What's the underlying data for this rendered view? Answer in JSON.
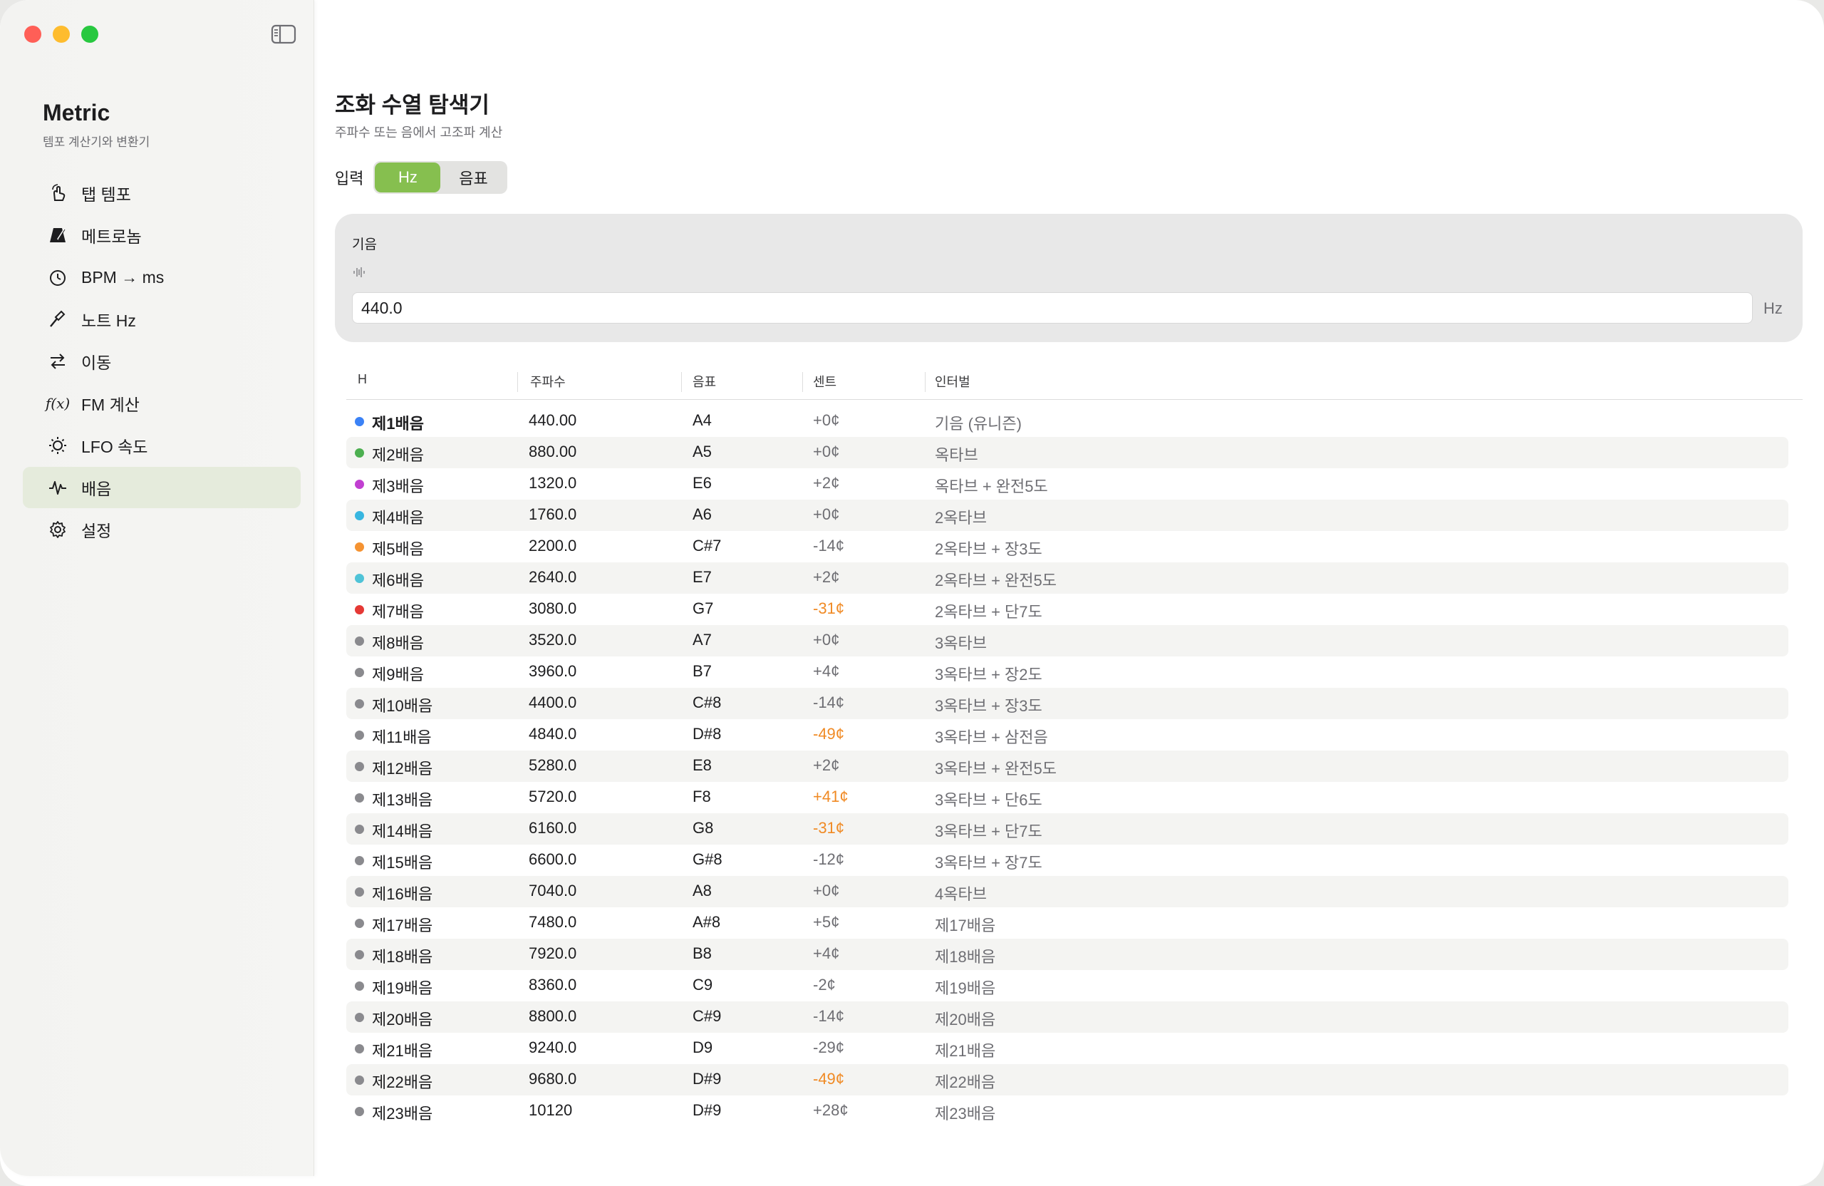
{
  "app": {
    "title": "Metric",
    "subtitle": "템포 계산기와 변환기"
  },
  "sidebar": {
    "items": [
      {
        "label": "탭 템포",
        "icon": "tap-icon"
      },
      {
        "label": "메트로놈",
        "icon": "metronome-icon"
      },
      {
        "label": "BPM → ms",
        "icon": "timer-icon"
      },
      {
        "label": "노트 Hz",
        "icon": "tuning-fork-icon"
      },
      {
        "label": "이동",
        "icon": "transpose-icon"
      },
      {
        "label": "FM 계산",
        "icon": "fx-icon",
        "glyph": "f(x)"
      },
      {
        "label": "LFO 속도",
        "icon": "lfo-icon"
      },
      {
        "label": "배음",
        "icon": "waveform-icon",
        "active": true
      },
      {
        "label": "설정",
        "icon": "gear-icon"
      }
    ]
  },
  "main": {
    "title": "조화 수열 탐색기",
    "subtitle": "주파수 또는 음에서 고조파 계산",
    "input_label": "입력",
    "modes": [
      "Hz",
      "음표"
    ],
    "selected_mode": "Hz",
    "fundamental_label": "기음",
    "fundamental_value": "440.0",
    "unit": "Hz"
  },
  "table": {
    "headers": [
      "H",
      "주파수",
      "음표",
      "센트",
      "인터벌"
    ],
    "rows": [
      {
        "h": "제1배음",
        "freq": "440.00",
        "note": "A4",
        "cents": "+0¢",
        "interval": "기음 (유니즌)",
        "color": "#3b82f6",
        "bold": true
      },
      {
        "h": "제2배음",
        "freq": "880.00",
        "note": "A5",
        "cents": "+0¢",
        "interval": "옥타브",
        "color": "#4caf50"
      },
      {
        "h": "제3배음",
        "freq": "1320.0",
        "note": "E6",
        "cents": "+2¢",
        "interval": "옥타브 + 완전5도",
        "color": "#c13fd1"
      },
      {
        "h": "제4배음",
        "freq": "1760.0",
        "note": "A6",
        "cents": "+0¢",
        "interval": "2옥타브",
        "color": "#38b6e0"
      },
      {
        "h": "제5배음",
        "freq": "2200.0",
        "note": "C#7",
        "cents": "-14¢",
        "interval": "2옥타브 + 장3도",
        "color": "#f59332"
      },
      {
        "h": "제6배음",
        "freq": "2640.0",
        "note": "E7",
        "cents": "+2¢",
        "interval": "2옥타브 + 완전5도",
        "color": "#4fc3d7"
      },
      {
        "h": "제7배음",
        "freq": "3080.0",
        "note": "G7",
        "cents": "-31¢",
        "interval": "2옥타브 + 단7도",
        "color": "#e53935",
        "warn": true
      },
      {
        "h": "제8배음",
        "freq": "3520.0",
        "note": "A7",
        "cents": "+0¢",
        "interval": "3옥타브",
        "color": "#8a8a8e"
      },
      {
        "h": "제9배음",
        "freq": "3960.0",
        "note": "B7",
        "cents": "+4¢",
        "interval": "3옥타브 + 장2도",
        "color": "#8a8a8e"
      },
      {
        "h": "제10배음",
        "freq": "4400.0",
        "note": "C#8",
        "cents": "-14¢",
        "interval": "3옥타브 + 장3도",
        "color": "#8a8a8e"
      },
      {
        "h": "제11배음",
        "freq": "4840.0",
        "note": "D#8",
        "cents": "-49¢",
        "interval": "3옥타브 + 삼전음",
        "color": "#8a8a8e",
        "warn": true
      },
      {
        "h": "제12배음",
        "freq": "5280.0",
        "note": "E8",
        "cents": "+2¢",
        "interval": "3옥타브 + 완전5도",
        "color": "#8a8a8e"
      },
      {
        "h": "제13배음",
        "freq": "5720.0",
        "note": "F8",
        "cents": "+41¢",
        "interval": "3옥타브 + 단6도",
        "color": "#8a8a8e",
        "warn": true
      },
      {
        "h": "제14배음",
        "freq": "6160.0",
        "note": "G8",
        "cents": "-31¢",
        "interval": "3옥타브 + 단7도",
        "color": "#8a8a8e",
        "warn": true
      },
      {
        "h": "제15배음",
        "freq": "6600.0",
        "note": "G#8",
        "cents": "-12¢",
        "interval": "3옥타브 + 장7도",
        "color": "#8a8a8e"
      },
      {
        "h": "제16배음",
        "freq": "7040.0",
        "note": "A8",
        "cents": "+0¢",
        "interval": "4옥타브",
        "color": "#8a8a8e"
      },
      {
        "h": "제17배음",
        "freq": "7480.0",
        "note": "A#8",
        "cents": "+5¢",
        "interval": "제17배음",
        "color": "#8a8a8e"
      },
      {
        "h": "제18배음",
        "freq": "7920.0",
        "note": "B8",
        "cents": "+4¢",
        "interval": "제18배음",
        "color": "#8a8a8e"
      },
      {
        "h": "제19배음",
        "freq": "8360.0",
        "note": "C9",
        "cents": "-2¢",
        "interval": "제19배음",
        "color": "#8a8a8e"
      },
      {
        "h": "제20배음",
        "freq": "8800.0",
        "note": "C#9",
        "cents": "-14¢",
        "interval": "제20배음",
        "color": "#8a8a8e"
      },
      {
        "h": "제21배음",
        "freq": "9240.0",
        "note": "D9",
        "cents": "-29¢",
        "interval": "제21배음",
        "color": "#8a8a8e"
      },
      {
        "h": "제22배음",
        "freq": "9680.0",
        "note": "D#9",
        "cents": "-49¢",
        "interval": "제22배음",
        "color": "#8a8a8e",
        "warn": true
      },
      {
        "h": "제23배음",
        "freq": "10120",
        "note": "D#9",
        "cents": "+28¢",
        "interval": "제23배음",
        "color": "#8a8a8e"
      }
    ]
  },
  "colors": {
    "accent": "#86bf4f",
    "warning": "#f08a24",
    "sidebar_active": "#e5ebdc"
  }
}
